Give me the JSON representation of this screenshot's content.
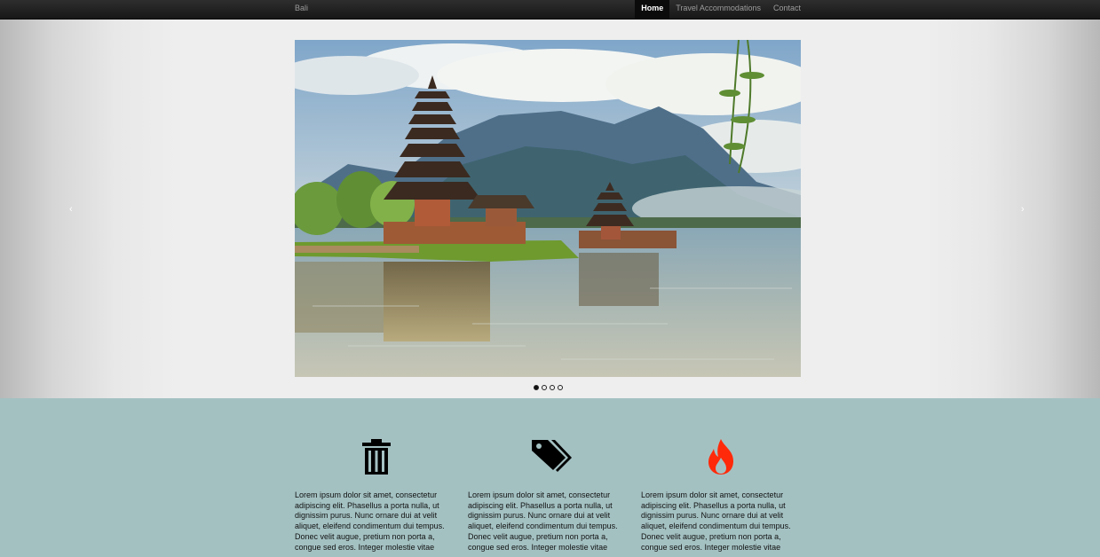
{
  "navbar": {
    "brand": "Bali",
    "items": [
      {
        "label": "Home",
        "active": true
      },
      {
        "label": "Travel Accommodations",
        "active": false
      },
      {
        "label": "Contact",
        "active": false
      }
    ]
  },
  "carousel": {
    "prev_icon": "chevron-left-icon",
    "prev_glyph": "‹",
    "next_icon": "chevron-right-icon",
    "next_glyph": "›",
    "slide_count": 4,
    "active_slide": 1
  },
  "features": [
    {
      "icon": "trash-icon",
      "icon_color": "#000000",
      "text": "Lorem ipsum dolor sit amet, consectetur adipiscing elit. Phasellus a porta nulla, ut dignissim purus. Nunc ornare dui at velit aliquet, eleifend condimentum dui tempus. Donec velit augue, pretium non porta a, congue sed eros. Integer molestie vitae"
    },
    {
      "icon": "tags-icon",
      "icon_color": "#000000",
      "text": "Lorem ipsum dolor sit amet, consectetur adipiscing elit. Phasellus a porta nulla, ut dignissim purus. Nunc ornare dui at velit aliquet, eleifend condimentum dui tempus. Donec velit augue, pretium non porta a, congue sed eros. Integer molestie vitae"
    },
    {
      "icon": "fire-icon",
      "icon_color": "#ff2a0a",
      "text": "Lorem ipsum dolor sit amet, consectetur adipiscing elit. Phasellus a porta nulla, ut dignissim purus. Nunc ornare dui at velit aliquet, eleifend condimentum dui tempus. Donec velit augue, pretium non porta a, congue sed eros. Integer molestie vitae"
    }
  ],
  "colors": {
    "navbar_bg": "#1f1f1f",
    "features_bg": "#a4c1c2",
    "carousel_bg": "#eeeeee"
  }
}
